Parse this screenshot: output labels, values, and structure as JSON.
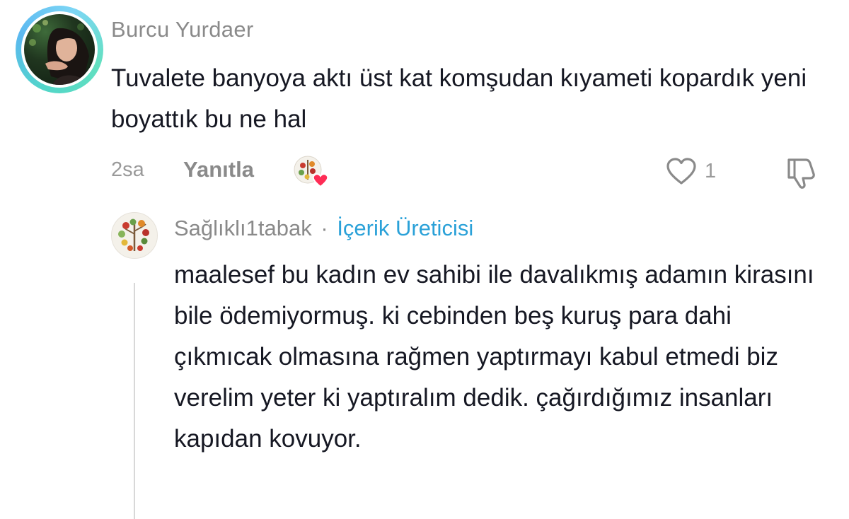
{
  "comment": {
    "username": "Burcu Yurdaer",
    "text": "Tuvalete banyoya aktı üst kat komşudan kıyameti kopardık yeni boyattık bu ne hal",
    "time": "2sa",
    "reply_label": "Yanıtla",
    "like_count": "1"
  },
  "reply": {
    "username": "Sağlıklı1tabak",
    "separator": "·",
    "badge": "İçerik Üreticisi",
    "text": "maalesef bu kadın ev sahibi ile davalıkmış adamın kirasını bile ödemiyormuş. ki cebinden beş kuruş para dahi çıkmıcak olmasına rağmen yaptırmayı kabul etmedi biz verelim yeter ki yaptıralım dedik. çağırdığımız insanları kapıdan kovuyor."
  },
  "colors": {
    "text": "#161823",
    "muted": "#8a8a8a",
    "badge": "#2aa1d8",
    "heart_badge": "#fe2c55",
    "story_ring": "#52d6c8"
  },
  "icons": {
    "like": "heart-outline-icon",
    "dislike": "thumbs-down-icon",
    "creator_liked": "creator-liked-heart-icon"
  }
}
